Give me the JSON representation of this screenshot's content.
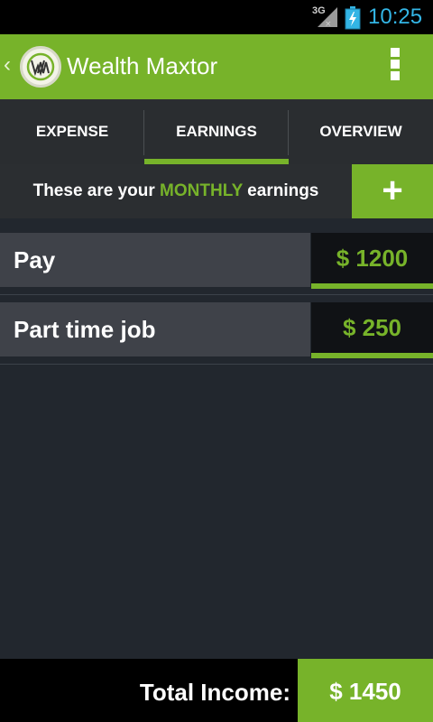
{
  "status_bar": {
    "network": "3G",
    "time": "10:25",
    "icons": [
      "signal-icon",
      "battery-charging-icon"
    ],
    "clock_color": "#33b5e5"
  },
  "action_bar": {
    "back_icon": "chevron-left-icon",
    "logo_icon": "wealth-maxtor-logo-icon",
    "title": "Wealth Maxtor",
    "overflow_icon": "overflow-menu-icon"
  },
  "tabs": [
    {
      "label": "EXPENSE",
      "active": false
    },
    {
      "label": "EARNINGS",
      "active": true
    },
    {
      "label": "OVERVIEW",
      "active": false
    }
  ],
  "info": {
    "prefix": "These are your ",
    "highlight": "MONTHLY",
    "suffix": " earnings",
    "add_label": "+"
  },
  "earnings": [
    {
      "name": "Pay",
      "amount": "$ 1200"
    },
    {
      "name": "Part time job",
      "amount": "$ 250"
    }
  ],
  "footer": {
    "label": "Total Income:",
    "total": "$ 1450"
  },
  "colors": {
    "accent": "#77b32a",
    "background": "#22272e",
    "row_label_bg": "#3f4249",
    "row_amount_bg": "#101215"
  }
}
